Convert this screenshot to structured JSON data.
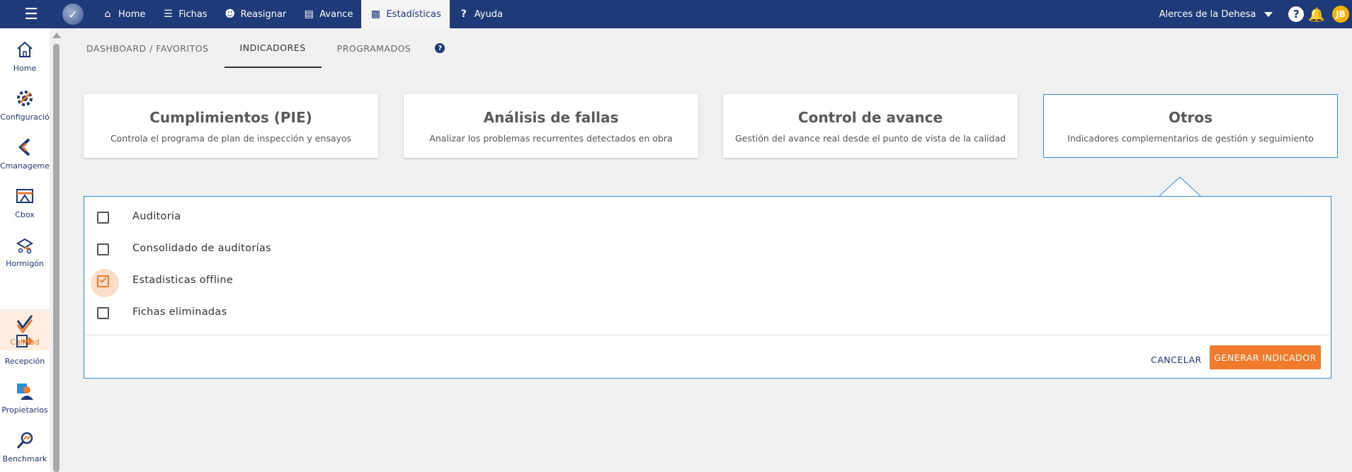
{
  "topbar": {
    "nav": [
      {
        "label": "Home",
        "icon": "home-icon"
      },
      {
        "label": "Fichas",
        "icon": "list-icon"
      },
      {
        "label": "Reasignar",
        "icon": "users-icon"
      },
      {
        "label": "Avance",
        "icon": "progress-icon"
      },
      {
        "label": "Estadísticas",
        "icon": "bar-chart-icon"
      },
      {
        "label": "Ayuda",
        "icon": "question-icon"
      }
    ],
    "active_nav": "Estadísticas",
    "project": "Alerces de la Dehesa",
    "avatar_initials": "JB"
  },
  "sidebar": {
    "items": [
      {
        "label": "Home",
        "icon": "house-icon"
      },
      {
        "label": "Configuració",
        "icon": "settings-icon"
      },
      {
        "label": "Cmanageme",
        "icon": "cmanagement-icon"
      },
      {
        "label": "Cbox",
        "icon": "cbox-icon"
      },
      {
        "label": "Hormigón",
        "icon": "concrete-mixer-icon"
      },
      {
        "label": "Calidad",
        "icon": "quality-check-icon"
      },
      {
        "label": "Recepción",
        "icon": "reception-icon"
      },
      {
        "label": "Propietarios",
        "icon": "owners-icon"
      },
      {
        "label": "Benchmark",
        "icon": "benchmark-icon"
      }
    ],
    "active_item": "Calidad"
  },
  "tabs": [
    {
      "label": "DASHBOARD / FAVORITOS"
    },
    {
      "label": "INDICADORES"
    },
    {
      "label": "PROGRAMADOS"
    }
  ],
  "active_tab": "INDICADORES",
  "cards": [
    {
      "title": "Cumplimientos (PIE)",
      "description": "Controla el programa de plan de inspección y ensayos"
    },
    {
      "title": "Análisis de fallas",
      "description": "Analizar los problemas recurrentes detectados en obra"
    },
    {
      "title": "Control de avance",
      "description": "Gestión del avance real desde el punto de vista de la calidad"
    },
    {
      "title": "Otros",
      "description": "Indicadores complementarios de gestión y seguimiento"
    }
  ],
  "active_card": "Otros",
  "options": [
    {
      "label": "Auditoria",
      "checked": false
    },
    {
      "label": "Consolidado de auditorías",
      "checked": false
    },
    {
      "label": "Estadisticas offline",
      "checked": true
    },
    {
      "label": "Fichas eliminadas",
      "checked": false
    }
  ],
  "actions": {
    "cancel_label": "CANCELAR",
    "generate_label": "GENERAR INDICADOR"
  },
  "colors": {
    "topbar": "#1e3a78",
    "accent": "#f07b2c",
    "card_active_border": "#2f8fd6"
  }
}
